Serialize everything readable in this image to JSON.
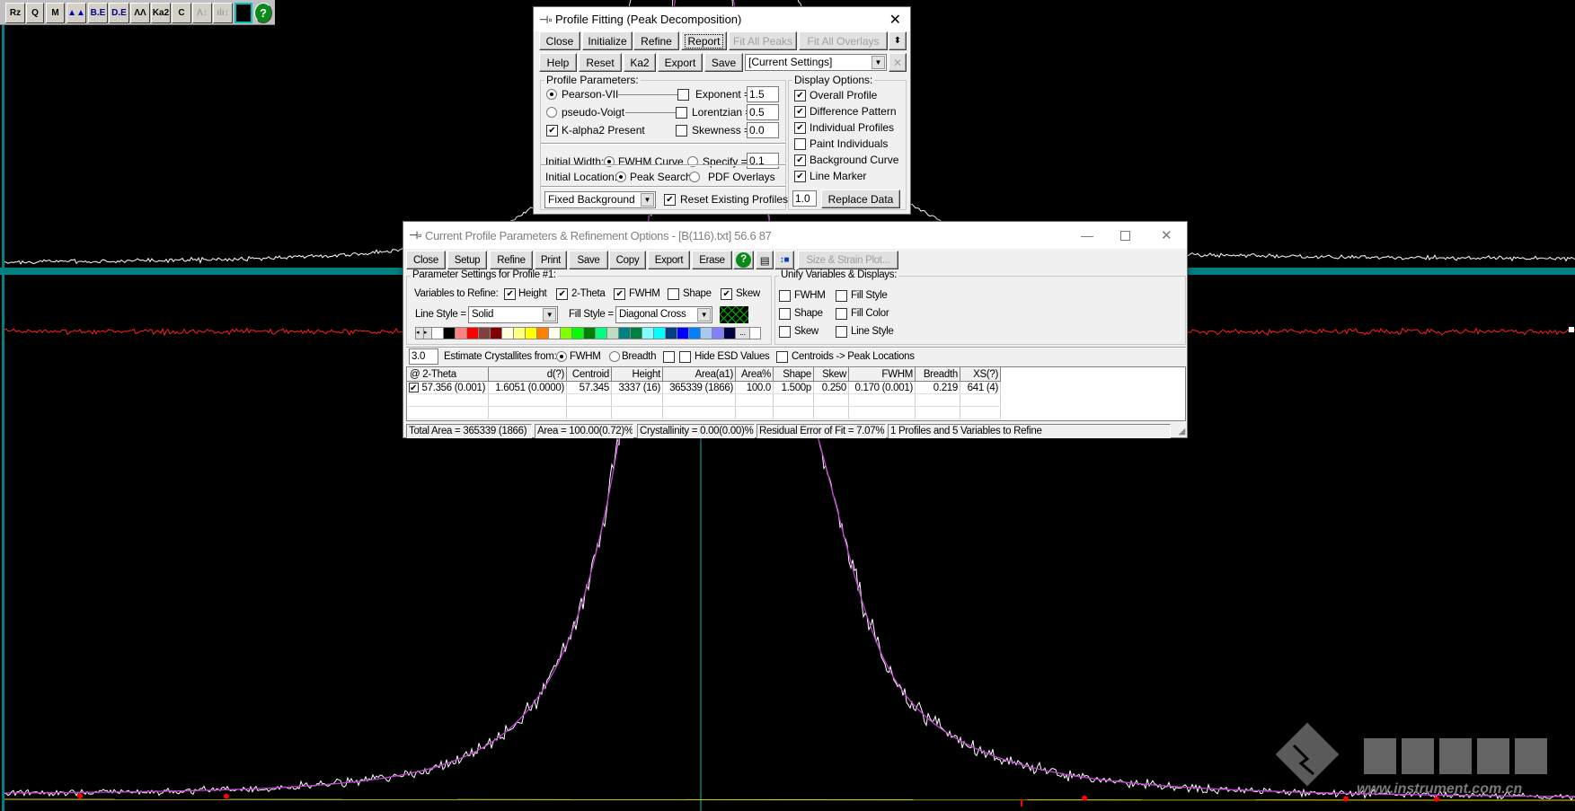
{
  "toolbar": {
    "buttons": [
      {
        "icon": "select-zoom-icon",
        "label": "Rz"
      },
      {
        "icon": "magnifier-icon",
        "label": "Q"
      },
      {
        "icon": "peak-marker-icon",
        "label": "M"
      },
      {
        "icon": "filled-peaks-icon",
        "label": "▲▲"
      },
      {
        "icon": "background-edit-icon",
        "label": "B.E"
      },
      {
        "icon": "data-edit-icon",
        "label": "D.E"
      },
      {
        "icon": "profile-peaks-icon",
        "label": "ΛΛ"
      },
      {
        "icon": "ka2-icon",
        "label": "Ka2"
      },
      {
        "icon": "calibrate-icon",
        "label": "C"
      },
      {
        "icon": "scale-peaks-icon",
        "label": "Λ↕"
      },
      {
        "icon": "scale-bars-icon",
        "label": "ılı↕"
      },
      {
        "icon": "grid-icon",
        "label": ""
      },
      {
        "icon": "help-icon",
        "label": "?"
      }
    ]
  },
  "profile_fitting": {
    "title": "Profile Fitting (Peak Decomposition)",
    "row1": [
      "Close",
      "Initialize",
      "Refine",
      "Report",
      "Fit All Peaks",
      "Fit All Overlays"
    ],
    "row2": [
      "Help",
      "Reset",
      "Ka2",
      "Export",
      "Save"
    ],
    "settings_combo": "[Current Settings]",
    "profile_parameters": {
      "title": "Profile Parameters:",
      "pearson": {
        "label": "Pearson-VII",
        "selected": true
      },
      "pseudo_voigt": {
        "label": "pseudo-Voigt",
        "selected": false
      },
      "kalpha2": {
        "label": "K-alpha2 Present",
        "checked": true
      },
      "exponent": {
        "label": "Exponent =",
        "value": "1.5",
        "checked": false
      },
      "lorentzian": {
        "label": "Lorentzian =",
        "value": "0.5",
        "checked": false
      },
      "skewness": {
        "label": "Skewness =",
        "value": "0.0",
        "checked": false
      }
    },
    "initial_width": {
      "label": "Initial Width:",
      "fwhm_curve": "FWHM Curve",
      "specify": "Specify =",
      "value": "0.1",
      "selected": "fwhm_curve"
    },
    "initial_location": {
      "label": "Initial Location:",
      "peak_search": "Peak Search",
      "pdf_overlays": "PDF Overlays",
      "selected": "peak_search"
    },
    "background_combo": "Fixed Background",
    "reset_existing": {
      "label": "Reset Existing Profiles",
      "checked": true
    },
    "display_options": {
      "title": "Display Options:",
      "items": [
        {
          "label": "Overall Profile",
          "checked": true
        },
        {
          "label": "Difference Pattern",
          "checked": true
        },
        {
          "label": "Individual Profiles",
          "checked": true
        },
        {
          "label": "Paint Individuals",
          "checked": false
        },
        {
          "label": "Background Curve",
          "checked": true
        },
        {
          "label": "Line Marker",
          "checked": true
        }
      ],
      "scale_value": "1.0",
      "replace_data": "Replace Data"
    }
  },
  "current_profile": {
    "title": "Current Profile Parameters & Refinement Options - [B(116).txt] 56.6      87",
    "toolbar": [
      "Close",
      "Setup",
      "Refine",
      "Print",
      "Save",
      "Copy",
      "Export",
      "Erase"
    ],
    "size_strain": "Size & Strain Plot...",
    "param_group": "Parameter Settings for Profile #1:",
    "variables_label": "Variables to Refine:",
    "variables": [
      {
        "label": "Height",
        "checked": true
      },
      {
        "label": "2-Theta",
        "checked": true
      },
      {
        "label": "FWHM",
        "checked": true
      },
      {
        "label": "Shape",
        "checked": false
      },
      {
        "label": "Skew",
        "checked": true
      }
    ],
    "line_style_label": "Line Style =",
    "line_style": "Solid",
    "fill_style_label": "Fill Style =",
    "fill_style": "Diagonal Cross",
    "palette": [
      "#ffffff",
      "#000000",
      "#ff8080",
      "#ff0000",
      "#804040",
      "#800000",
      "#ffffe0",
      "#ffff80",
      "#ffff00",
      "#ff8000",
      "#fffff0",
      "#80ff00",
      "#00ff00",
      "#008000",
      "#00ff80",
      "#c0dcc0",
      "#008080",
      "#008040",
      "#80ffff",
      "#00ffff",
      "#004080",
      "#0000ff",
      "#0080ff",
      "#a6caf0",
      "#8080ff",
      "#000040"
    ],
    "unify_group": "Unify Variables & Displays:",
    "unify": [
      {
        "label": "FWHM",
        "checked": false
      },
      {
        "label": "Fill Style",
        "checked": false
      },
      {
        "label": "Shape",
        "checked": false
      },
      {
        "label": "Fill Color",
        "checked": false
      },
      {
        "label": "Skew",
        "checked": false
      },
      {
        "label": "Line Style",
        "checked": false
      }
    ],
    "crystallite_value": "3.0",
    "estimate_label": "Estimate Crystallites from:",
    "est_fwhm": "FWHM",
    "est_breadth": "Breadth",
    "hide_esd": "Hide ESD Values",
    "centroids": "Centroids -> Peak Locations",
    "table": {
      "headers": [
        "@ 2-Theta",
        "d(?)",
        "Centroid",
        "Height",
        "Area(a1)",
        "Area%",
        "Shape",
        "Skew",
        "FWHM",
        "Breadth",
        "XS(?)"
      ],
      "rows": [
        {
          "checked": true,
          "cells": [
            "57.356 (0.001)",
            "1.6051 (0.0000)",
            "57.345",
            "3337 (16)",
            "365339 (1866)",
            "100.0",
            "1.500p",
            "0.250",
            "0.170 (0.001)",
            "0.219",
            "641 (4)"
          ]
        }
      ]
    },
    "status": [
      "Total Area = 365339 (1866)",
      "Area = 100.00(0.72)%",
      "Crystallinity = 0.00(0.00)%",
      "Residual Error of Fit = 7.07%",
      "1 Profiles and 5 Variables to Refine"
    ]
  },
  "watermark": {
    "logo_text": "仪器信息网",
    "url": "www.instrument.com.cn"
  },
  "colors": {
    "observed": "#ffffff",
    "fit": "#c040d0",
    "difference": "#ff2020",
    "marker": "#00c0c0",
    "band": "#008080",
    "background_curve": "#e0e000",
    "peak_dots": "#ff0000"
  }
}
